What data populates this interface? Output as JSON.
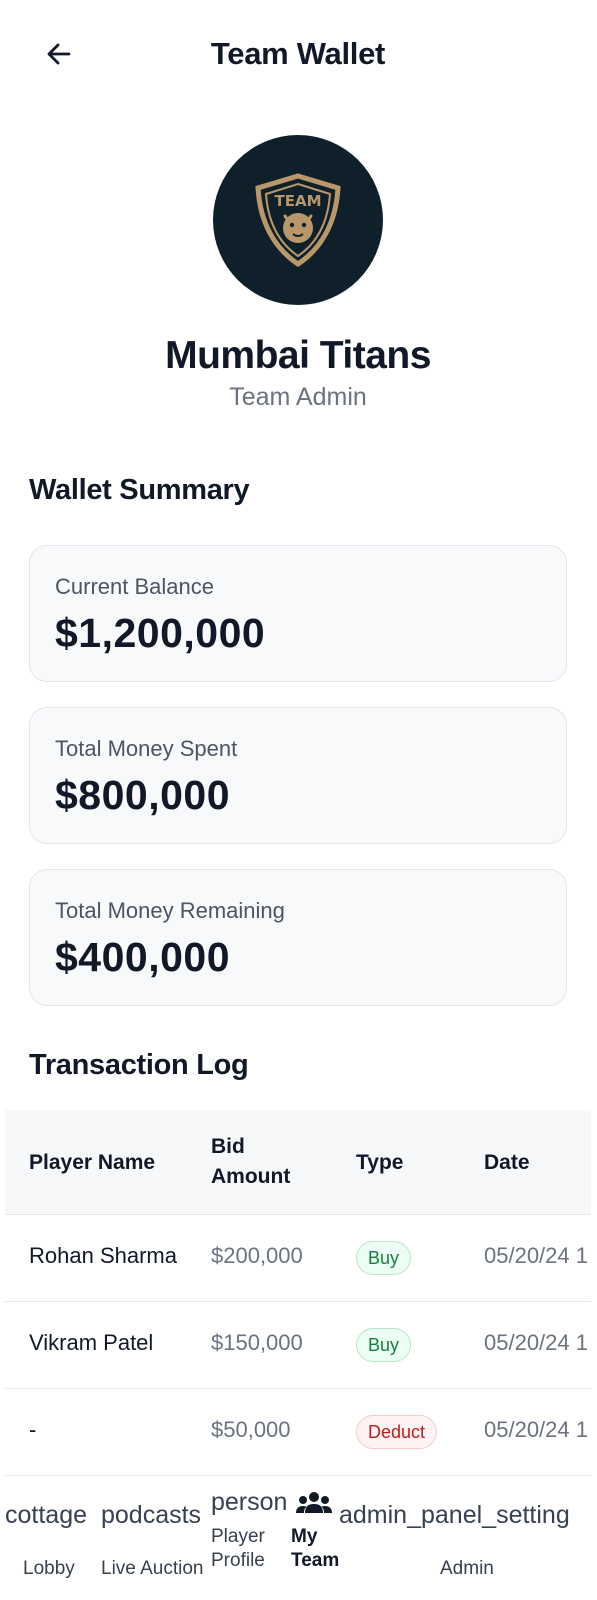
{
  "header": {
    "title": "Team Wallet",
    "back_icon": "arrow-left-icon"
  },
  "profile": {
    "logo_text": "TEAM",
    "team_name": "Mumbai Titans",
    "role": "Team Admin"
  },
  "wallet_summary": {
    "title": "Wallet Summary",
    "cards": [
      {
        "label": "Current Balance",
        "value": "$1,200,000"
      },
      {
        "label": "Total Money Spent",
        "value": "$800,000"
      },
      {
        "label": "Total Money Remaining",
        "value": "$400,000"
      }
    ]
  },
  "transactions": {
    "title": "Transaction Log",
    "columns": {
      "player": "Player Name",
      "bid_line1": "Bid",
      "bid_line2": "Amount",
      "type": "Type",
      "date": "Date"
    },
    "rows": [
      {
        "player": "Rohan Sharma",
        "amount": "$200,000",
        "type": "Buy",
        "date": "05/20/24 1"
      },
      {
        "player": "Vikram Patel",
        "amount": "$150,000",
        "type": "Buy",
        "date": "05/20/24 1"
      },
      {
        "player": "-",
        "amount": "$50,000",
        "type": "Deduct",
        "date": "05/20/24 1"
      }
    ]
  },
  "bottom_nav": {
    "items": [
      {
        "icon_text": "cottage",
        "label": "Lobby"
      },
      {
        "icon_text": "podcasts",
        "label": "Live Auction"
      },
      {
        "icon_text": "person",
        "label_line1": "Player",
        "label_line2": "Profile"
      },
      {
        "icon_name": "group-icon",
        "label_line1": "My",
        "label_line2": "Team",
        "active": true
      },
      {
        "icon_text": "admin_panel_setting",
        "label": "Admin"
      }
    ]
  },
  "colors": {
    "logo_bg": "#10202a",
    "logo_gold": "#b8986a",
    "buy": "#15803d",
    "deduct": "#b91c1c"
  }
}
